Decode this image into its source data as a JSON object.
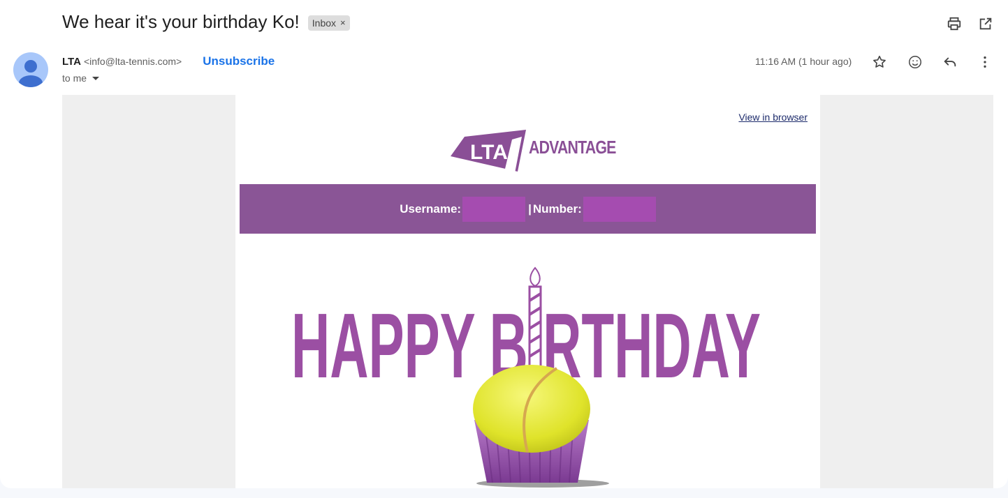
{
  "email": {
    "subject": "We hear it's your birthday Ko!",
    "label": "Inbox",
    "label_remove": "×",
    "sender_name": "LTA",
    "sender_email": "<info@lta-tennis.com>",
    "unsubscribe": "Unsubscribe",
    "recipient": "to me",
    "timestamp": "11:16 AM (1 hour ago)"
  },
  "body": {
    "view_in_browser": "View in browser",
    "logo_word": "ADVANTAGE",
    "username_label": "Username:",
    "separator": "|",
    "number_label": "Number:",
    "hero_text": "HAPPY BIRTHDAY"
  },
  "icons": {
    "print": "print-icon",
    "open_new": "open-in-new-window-icon",
    "star": "star-icon",
    "emoji": "emoji-icon",
    "reply": "reply-icon",
    "more": "more-vertical-icon"
  },
  "colors": {
    "brand_purple": "#8a5596",
    "hero_purple": "#9b4fa3",
    "link_blue": "#1a73e8"
  }
}
